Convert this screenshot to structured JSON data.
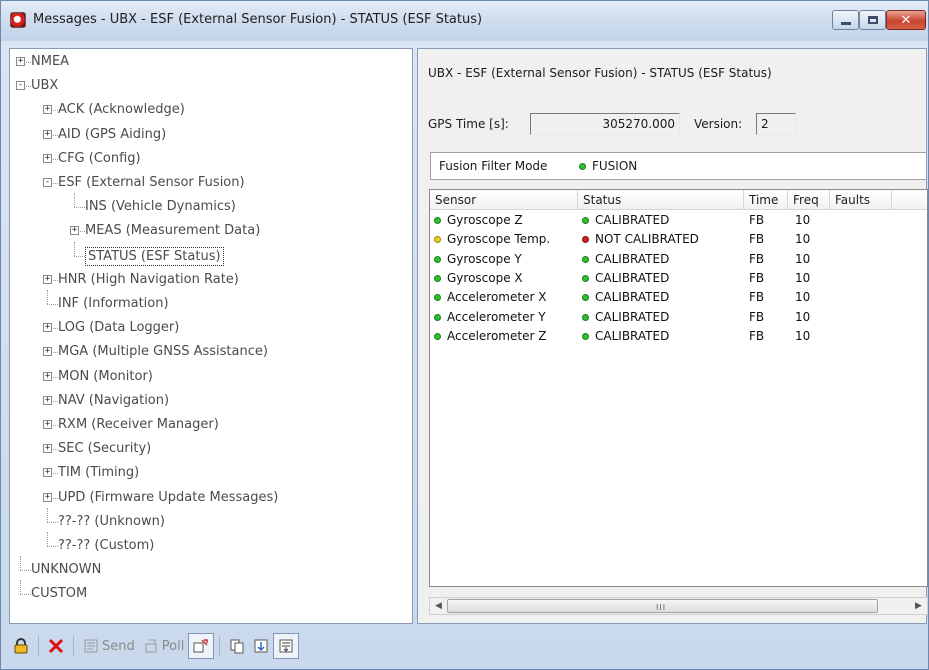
{
  "window": {
    "title": "Messages - UBX - ESF (External Sensor Fusion) - STATUS (ESF Status)"
  },
  "tree": {
    "items": [
      {
        "label": "NMEA",
        "expander": "+"
      },
      {
        "label": "UBX",
        "expander": "-"
      },
      {
        "label": "ACK (Acknowledge)",
        "expander": "+"
      },
      {
        "label": "AID (GPS Aiding)",
        "expander": "+"
      },
      {
        "label": "CFG (Config)",
        "expander": "+"
      },
      {
        "label": "ESF (External Sensor Fusion)",
        "expander": "-"
      },
      {
        "label": "INS (Vehicle Dynamics)",
        "expander": ""
      },
      {
        "label": "MEAS (Measurement Data)",
        "expander": "+"
      },
      {
        "label": "STATUS (ESF Status)",
        "expander": ""
      },
      {
        "label": "HNR (High Navigation Rate)",
        "expander": "+"
      },
      {
        "label": "INF (Information)",
        "expander": ""
      },
      {
        "label": "LOG (Data Logger)",
        "expander": "+"
      },
      {
        "label": "MGA (Multiple GNSS Assistance)",
        "expander": "+"
      },
      {
        "label": "MON (Monitor)",
        "expander": "+"
      },
      {
        "label": "NAV (Navigation)",
        "expander": "+"
      },
      {
        "label": "RXM (Receiver Manager)",
        "expander": "+"
      },
      {
        "label": "SEC (Security)",
        "expander": "+"
      },
      {
        "label": "TIM (Timing)",
        "expander": "+"
      },
      {
        "label": "UPD (Firmware Update Messages)",
        "expander": "+"
      },
      {
        "label": "??-?? (Unknown)",
        "expander": ""
      },
      {
        "label": "??-?? (Custom)",
        "expander": ""
      },
      {
        "label": "UNKNOWN",
        "expander": ""
      },
      {
        "label": "CUSTOM",
        "expander": ""
      }
    ]
  },
  "status_panel": {
    "heading": "UBX - ESF (External Sensor Fusion) - STATUS (ESF Status)",
    "gps_time_label": "GPS Time [s]:",
    "gps_time_value": "305270.000",
    "version_label": "Version:",
    "version_value": "2",
    "fusion_mode_label": "Fusion Filter Mode",
    "fusion_mode_value": "FUSION",
    "fusion_mode_color": "#2fbf2f",
    "table": {
      "columns": [
        "Sensor",
        "Status",
        "Time",
        "Freq",
        "Faults"
      ],
      "rows": [
        {
          "sensor": "Gyroscope Z",
          "sensor_color": "#2fbf2f",
          "status": "CALIBRATED",
          "status_color": "#2fbf2f",
          "time": "FB",
          "freq": "10",
          "faults": ""
        },
        {
          "sensor": "Gyroscope Temp.",
          "sensor_color": "#e8d21c",
          "status": "NOT CALIBRATED",
          "status_color": "#d01e1e",
          "time": "FB",
          "freq": "10",
          "faults": ""
        },
        {
          "sensor": "Gyroscope Y",
          "sensor_color": "#2fbf2f",
          "status": "CALIBRATED",
          "status_color": "#2fbf2f",
          "time": "FB",
          "freq": "10",
          "faults": ""
        },
        {
          "sensor": "Gyroscope X",
          "sensor_color": "#2fbf2f",
          "status": "CALIBRATED",
          "status_color": "#2fbf2f",
          "time": "FB",
          "freq": "10",
          "faults": ""
        },
        {
          "sensor": "Accelerometer X",
          "sensor_color": "#2fbf2f",
          "status": "CALIBRATED",
          "status_color": "#2fbf2f",
          "time": "FB",
          "freq": "10",
          "faults": ""
        },
        {
          "sensor": "Accelerometer Y",
          "sensor_color": "#2fbf2f",
          "status": "CALIBRATED",
          "status_color": "#2fbf2f",
          "time": "FB",
          "freq": "10",
          "faults": ""
        },
        {
          "sensor": "Accelerometer Z",
          "sensor_color": "#2fbf2f",
          "status": "CALIBRATED",
          "status_color": "#2fbf2f",
          "time": "FB",
          "freq": "10",
          "faults": ""
        }
      ]
    },
    "scrollbar_grip": "III"
  },
  "toolbar": {
    "send_label": "Send",
    "poll_label": "Poll",
    "icons": [
      "lock-icon",
      "delete-icon",
      "send-icon",
      "poll-icon",
      "auto-poll-icon",
      "copy-icon",
      "scroll-icon",
      "auto-scroll-icon"
    ]
  }
}
